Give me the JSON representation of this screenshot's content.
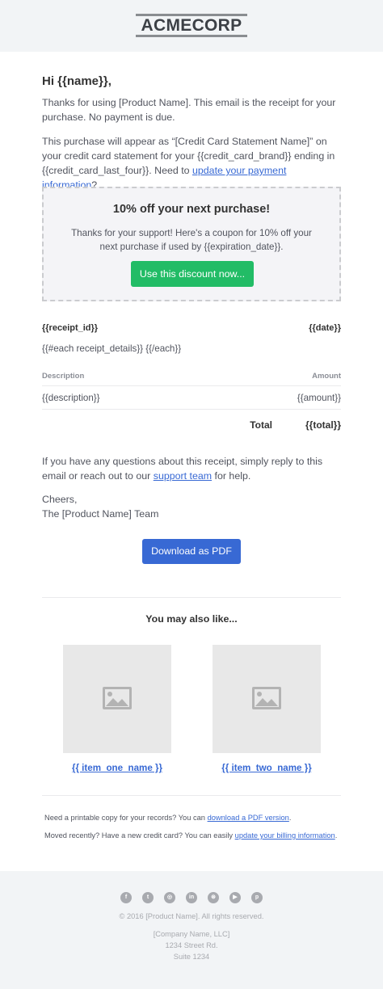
{
  "header": {
    "logo_text": "ACMECORP"
  },
  "greeting": "Hi {{name}},",
  "intro": "Thanks for using [Product Name]. This email is the receipt for your purchase. No payment is due.",
  "statement": {
    "text": "This purchase will appear as “[Credit Card Statement Name]” on your credit card statement for your {{credit_card_brand}} ending in {{credit_card_last_four}}. Need to ",
    "link": "update your payment information",
    "suffix": "?"
  },
  "coupon": {
    "title": "10% off your next purchase!",
    "text": "Thanks for your support! Here's a coupon for 10% off your next purchase if used by {{expiration_date}}.",
    "button": "Use this discount now..."
  },
  "receipt": {
    "id": "{{receipt_id}}",
    "date": "{{date}}",
    "each_tag": "{{#each receipt_details}} {{/each}}",
    "col_description": "Description",
    "col_amount": "Amount",
    "row_description": "{{description}}",
    "row_amount": "{{amount}}",
    "total_label": "Total",
    "total_value": "{{total}}"
  },
  "questions": {
    "text": "If you have any questions about this receipt, simply reply to this email or reach out to our ",
    "link": "support team",
    "suffix": " for help."
  },
  "signoff": {
    "line1": "Cheers,",
    "line2": "The [Product Name] Team"
  },
  "download_button": "Download as PDF",
  "also_like": {
    "title": "You may also like...",
    "item_one": "{{ item_one_name }}",
    "item_two": "{{ item_two_name }}"
  },
  "notes": {
    "pdf_text": "Need a printable copy for your records? You can ",
    "pdf_link": "download a PDF version",
    "pdf_suffix": ".",
    "billing_text": "Moved recently? Have a new credit card? You can easily ",
    "billing_link": "update your billing information",
    "billing_suffix": "."
  },
  "footer": {
    "copyright": "© 2016 [Product Name]. All rights reserved.",
    "address_line1": "[Company Name, LLC]",
    "address_line2": "1234 Street Rd.",
    "address_line3": "Suite 1234",
    "social_icons": [
      "facebook-icon",
      "twitter-icon",
      "instagram-icon",
      "linkedin-icon",
      "dribbble-icon",
      "youtube-icon",
      "pinterest-icon"
    ]
  },
  "colors": {
    "accent_blue": "#3869d4",
    "accent_green": "#22bc66",
    "header_bg": "#f2f4f6",
    "body_text": "#51545e"
  }
}
